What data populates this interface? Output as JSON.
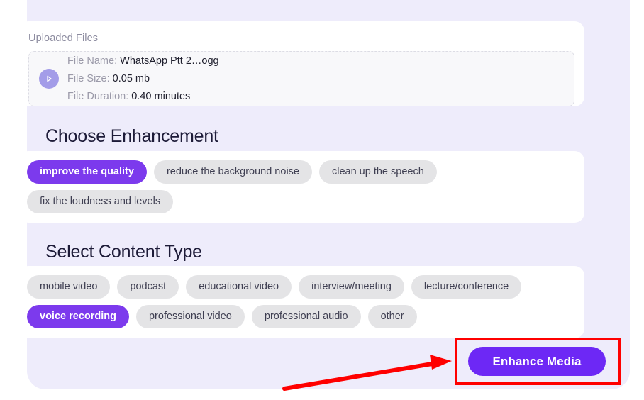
{
  "uploaded_files": {
    "section_label": "Uploaded Files",
    "icon": "play-circle-icon",
    "rows": [
      {
        "label": "File Name:",
        "value": "WhatsApp Ptt 2…ogg"
      },
      {
        "label": "File Size:",
        "value": "0.05 mb"
      },
      {
        "label": "File Duration:",
        "value": "0.40 minutes"
      }
    ]
  },
  "enhancement": {
    "heading": "Choose Enhancement",
    "options": [
      {
        "label": "improve the quality",
        "selected": true
      },
      {
        "label": "reduce the background noise",
        "selected": false
      },
      {
        "label": "clean up the speech",
        "selected": false
      },
      {
        "label": "fix the loudness and levels",
        "selected": false
      }
    ]
  },
  "content_type": {
    "heading": "Select Content Type",
    "options": [
      {
        "label": "mobile video",
        "selected": false
      },
      {
        "label": "podcast",
        "selected": false
      },
      {
        "label": "educational video",
        "selected": false
      },
      {
        "label": "interview/meeting",
        "selected": false
      },
      {
        "label": "lecture/conference",
        "selected": false
      },
      {
        "label": "voice recording",
        "selected": true
      },
      {
        "label": "professional video",
        "selected": false
      },
      {
        "label": "professional audio",
        "selected": false
      },
      {
        "label": "other",
        "selected": false
      }
    ]
  },
  "actions": {
    "enhance_label": "Enhance Media"
  },
  "colors": {
    "accent_purple": "#7c3aed",
    "button_purple": "#6d28f5",
    "panel_lavender": "#eeecfb",
    "pill_gray": "#e4e4e6",
    "heading_navy": "#1d1b38",
    "annotation_red": "#ff0000",
    "play_circle_purple": "#a39ce8"
  },
  "annotations": {
    "highlight_box": "enhance-media-button-highlight",
    "arrow": "pointer-arrow-to-enhance-media"
  }
}
